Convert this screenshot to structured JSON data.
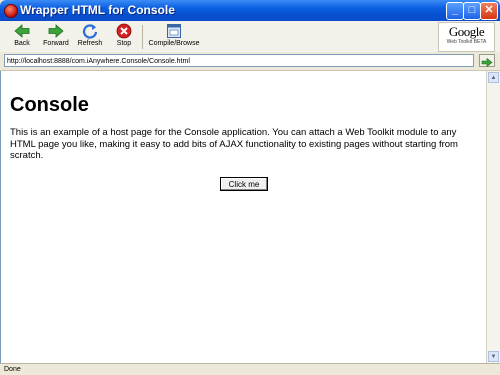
{
  "window": {
    "title": "Wrapper HTML for Console",
    "buttons": {
      "minimize": "_",
      "maximize": "□",
      "close": "✕"
    }
  },
  "toolbar": {
    "back_label": "Back",
    "forward_label": "Forward",
    "refresh_label": "Refresh",
    "stop_label": "Stop",
    "compile_label": "Compile/Browse",
    "logo_text": "Google",
    "logo_sub": "Web Toolkit BETA",
    "icons": {
      "back": "back-arrow-icon",
      "forward": "forward-arrow-icon",
      "refresh": "refresh-icon",
      "stop": "stop-icon",
      "compile": "compile-browse-icon"
    }
  },
  "address": {
    "value": "http://localhost:8888/com.iAnywhere.Console/Console.html"
  },
  "page": {
    "heading": "Console",
    "body_text": "This is an example of a host page for the Console application. You can attach a Web Toolkit module to any HTML page you like, making it easy to add bits of AJAX functionality to existing pages without starting from scratch.",
    "button_label": "Click me"
  },
  "status": {
    "text": "Done"
  },
  "colors": {
    "titlebar": "#0a5ee0",
    "chrome": "#ece9d8",
    "back_arrow": "#2e9a2e",
    "stop": "#d42020"
  }
}
